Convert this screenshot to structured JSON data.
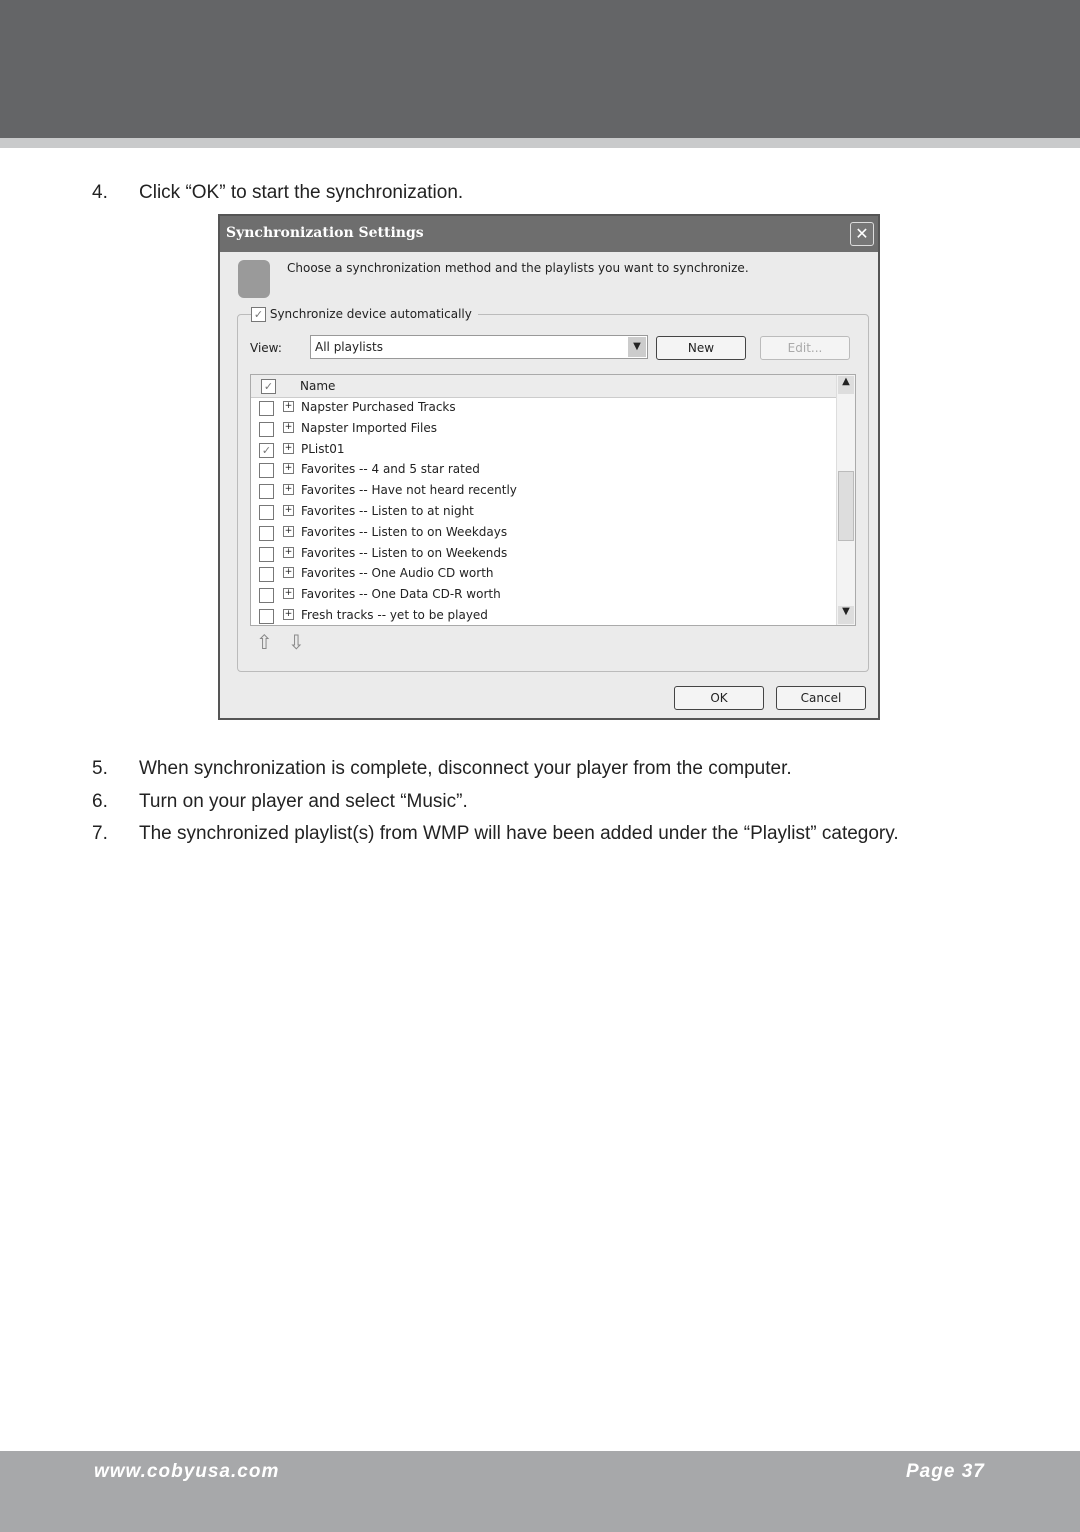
{
  "steps": [
    {
      "num": "4.",
      "text": "Click “OK” to start the synchronization."
    },
    {
      "num": "5.",
      "text": "When synchronization is complete, disconnect your player from the computer."
    },
    {
      "num": "6.",
      "text": "Turn on your player and select “Music”."
    },
    {
      "num": "7.",
      "text": "The synchronized playlist(s) from WMP will have been added under the “Playlist” category."
    }
  ],
  "dialog": {
    "title": "Synchronization Settings",
    "close": "✕",
    "instruction": "Choose a synchronization method and the playlists you want to synchronize.",
    "auto_sync_label": "Synchronize device automatically",
    "auto_sync_checked": true,
    "view_label": "View:",
    "view_value": "All playlists",
    "new_label": "New",
    "edit_label": "Edit...",
    "column_name": "Name",
    "playlists": [
      {
        "name": "Napster Purchased Tracks",
        "checked": false
      },
      {
        "name": "Napster Imported Files",
        "checked": false
      },
      {
        "name": "PList01",
        "checked": true
      },
      {
        "name": "Favorites -- 4 and 5 star rated",
        "checked": false
      },
      {
        "name": "Favorites -- Have not heard recently",
        "checked": false
      },
      {
        "name": "Favorites -- Listen to at night",
        "checked": false
      },
      {
        "name": "Favorites -- Listen to on Weekdays",
        "checked": false
      },
      {
        "name": "Favorites -- Listen to on Weekends",
        "checked": false
      },
      {
        "name": "Favorites -- One Audio CD worth",
        "checked": false
      },
      {
        "name": "Favorites -- One Data CD-R worth",
        "checked": false
      },
      {
        "name": "Fresh tracks -- yet to be played",
        "checked": false
      }
    ],
    "ok_label": "OK",
    "cancel_label": "Cancel"
  },
  "footer": {
    "url": "www.cobyusa.com",
    "page": "Page 37"
  }
}
